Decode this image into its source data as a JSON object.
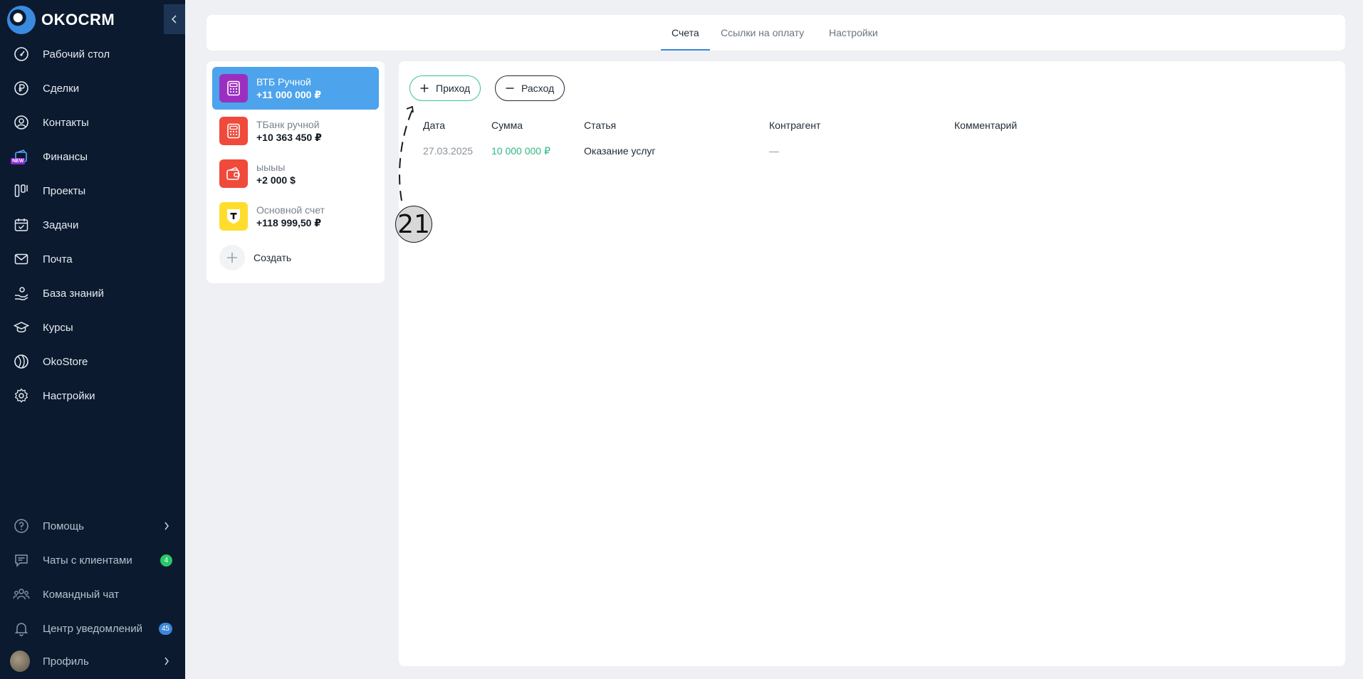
{
  "app": {
    "brand": "OKOCRM"
  },
  "sidebar": {
    "items": [
      {
        "label": "Рабочий стол",
        "icon": "dashboard-gauge-icon"
      },
      {
        "label": "Сделки",
        "icon": "ruble-icon"
      },
      {
        "label": "Контакты",
        "icon": "user-circle-icon"
      },
      {
        "label": "Финансы",
        "icon": "wallet-icon",
        "badge": "NEW"
      },
      {
        "label": "Проекты",
        "icon": "kanban-icon"
      },
      {
        "label": "Задачи",
        "icon": "calendar-check-icon"
      },
      {
        "label": "Почта",
        "icon": "mail-icon"
      },
      {
        "label": "База знаний",
        "icon": "knowledge-hand-icon"
      },
      {
        "label": "Курсы",
        "icon": "graduation-cap-icon"
      },
      {
        "label": "OkoStore",
        "icon": "store-globe-icon"
      },
      {
        "label": "Настройки",
        "icon": "gear-icon"
      }
    ],
    "bottom": [
      {
        "label": "Помощь",
        "icon": "help-icon"
      },
      {
        "label": "Чаты с клиентами",
        "icon": "chat-icon",
        "count": "4"
      },
      {
        "label": "Командный чат",
        "icon": "team-icon"
      },
      {
        "label": "Центр уведомлений",
        "icon": "bell-icon",
        "count": "45"
      },
      {
        "label": "Профиль",
        "icon": "avatar"
      }
    ]
  },
  "tabs": [
    {
      "label": "Счета",
      "active": true
    },
    {
      "label": "Ссылки на оплату",
      "active": false
    },
    {
      "label": "Настройки",
      "active": false
    }
  ],
  "accounts": [
    {
      "name": "ВТБ Ручной",
      "amount": "+11 000 000 ₽",
      "active": true,
      "icon": "calculator-icon",
      "color": "#9b2fc0"
    },
    {
      "name": "ТБанк ручной",
      "amount": "+10 363 450 ₽",
      "active": false,
      "icon": "calculator-icon",
      "color": "#ef4a3c"
    },
    {
      "name": "ыыыы",
      "amount": "+2 000 $",
      "active": false,
      "icon": "wallet-card-icon",
      "color": "#ef4a3c"
    },
    {
      "name": "Основной счет",
      "amount": "+118 999,50 ₽",
      "active": false,
      "icon": "tbank-logo-icon",
      "color": "#ffdd2d"
    }
  ],
  "create_label": "Создать",
  "actions": {
    "income_label": "Приход",
    "expense_label": "Расход"
  },
  "table": {
    "headers": [
      "Дата",
      "Сумма",
      "Статья",
      "Контрагент",
      "Комментарий"
    ],
    "rows": [
      {
        "date": "27.03.2025",
        "sum": "10 000 000 ₽",
        "article": "Оказание услуг",
        "counterparty": "—",
        "comment": ""
      }
    ]
  },
  "annotation": {
    "label": "21"
  },
  "colors": {
    "sidebar_bg": "#0b1a2e",
    "accent_blue": "#4da3ec",
    "income_green": "#3cbf92",
    "badge_green": "#2ac769",
    "badge_blue": "#3b86d9"
  }
}
